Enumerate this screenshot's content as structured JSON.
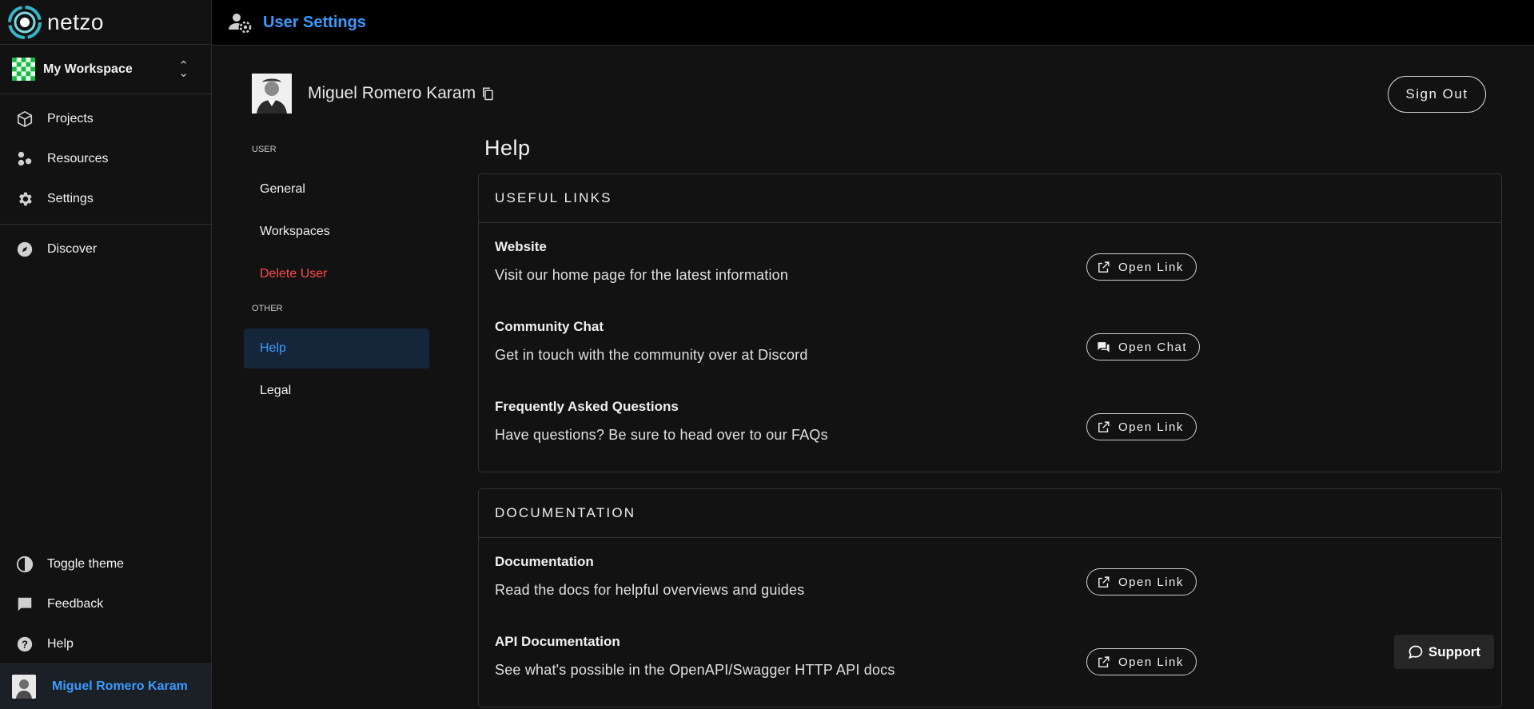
{
  "brand": {
    "name": "netzo"
  },
  "workspace": {
    "name": "My Workspace"
  },
  "nav": {
    "items": [
      {
        "label": "Projects"
      },
      {
        "label": "Resources"
      },
      {
        "label": "Settings"
      },
      {
        "label": "Discover"
      }
    ],
    "bottom": [
      {
        "label": "Toggle theme"
      },
      {
        "label": "Feedback"
      },
      {
        "label": "Help"
      }
    ],
    "user": {
      "name": "Miguel Romero Karam"
    }
  },
  "topbar": {
    "title": "User Settings"
  },
  "profile": {
    "name": "Miguel Romero Karam",
    "signout_label": "Sign Out"
  },
  "subnav": {
    "user_heading": "USER",
    "other_heading": "OTHER",
    "items": [
      {
        "label": "General"
      },
      {
        "label": "Workspaces"
      },
      {
        "label": "Delete User"
      },
      {
        "label": "Help"
      },
      {
        "label": "Legal"
      }
    ]
  },
  "help": {
    "title": "Help",
    "sections": [
      {
        "heading": "USEFUL LINKS",
        "rows": [
          {
            "title": "Website",
            "desc": "Visit our home page for the latest information",
            "button": "Open Link",
            "icon": "open-in-new-icon"
          },
          {
            "title": "Community Chat",
            "desc": "Get in touch with the community over at Discord",
            "button": "Open Chat",
            "icon": "forum-icon"
          },
          {
            "title": "Frequently Asked Questions",
            "desc": "Have questions? Be sure to head over to our FAQs",
            "button": "Open Link",
            "icon": "open-in-new-icon"
          }
        ]
      },
      {
        "heading": "DOCUMENTATION",
        "rows": [
          {
            "title": "Documentation",
            "desc": "Read the docs for helpful overviews and guides",
            "button": "Open Link",
            "icon": "open-in-new-icon"
          },
          {
            "title": "API Documentation",
            "desc": "See what's possible in the OpenAPI/Swagger HTTP API docs",
            "button": "Open Link",
            "icon": "open-in-new-icon"
          }
        ]
      }
    ]
  },
  "support": {
    "label": "Support"
  },
  "colors": {
    "accent": "#3b9bff",
    "danger": "#ff4b4b",
    "active_bg": "#15263a"
  }
}
